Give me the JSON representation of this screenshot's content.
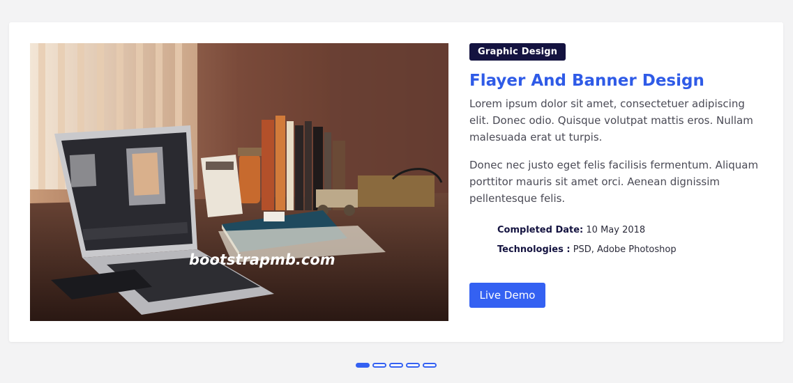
{
  "slide": {
    "image_watermark": "bootstrapmb.com",
    "category_badge": "Graphic Design",
    "title": "Flayer And Banner Design",
    "paragraph_1": "Lorem ipsum dolor sit amet, consectetuer adipiscing elit. Donec odio. Quisque volutpat mattis eros. Nullam malesuada erat ut turpis.",
    "paragraph_2": "Donec nec justo eget felis facilisis fermentum. Aliquam porttitor mauris sit amet orci. Aenean dignissim pellentesque felis.",
    "completed_label": "Completed Date:",
    "completed_value": "10 May 2018",
    "technologies_label": "Technologies :",
    "technologies_value": "PSD, Adobe Photoshop",
    "live_demo_label": "Live Demo"
  },
  "carousel": {
    "total_slides": 5,
    "active_index": 0
  },
  "colors": {
    "accent": "#3461f2",
    "title": "#2f5be7",
    "badge_bg": "#141340",
    "page_bg": "#f3f3f4"
  }
}
